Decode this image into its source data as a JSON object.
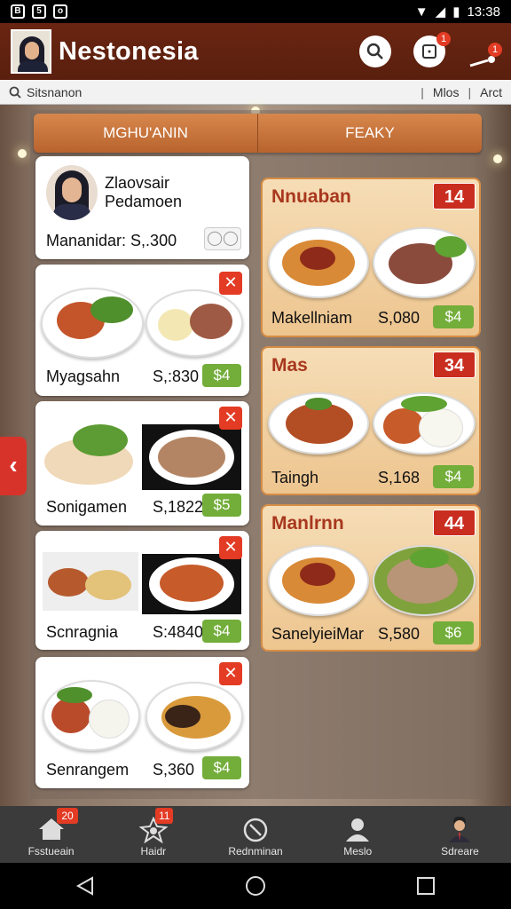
{
  "status": {
    "time": "13:38"
  },
  "app": {
    "title": "Nestonesia"
  },
  "header": {
    "notif_badge": "1",
    "alert_badge": "1"
  },
  "search": {
    "placeholder": "Sitsnanon",
    "link1": "Mlos",
    "link2": "Arct"
  },
  "tabs": [
    {
      "label": "MGHU'ANIN"
    },
    {
      "label": "FEAKY"
    }
  ],
  "profile": {
    "name_line1": "Zlaovsair",
    "name_line2": "Pedamoen",
    "balance": "Mananidar: S,.300"
  },
  "left_items": [
    {
      "name": "Myagsahn",
      "price": "S,:830",
      "tag": "$4"
    },
    {
      "name": "Sonigamen",
      "price": "S,1822",
      "tag": "$5"
    },
    {
      "name": "Scnragnia",
      "price": "S:4840",
      "tag": "$4"
    },
    {
      "name": "Senrangem",
      "price": "S,360",
      "tag": "$4"
    }
  ],
  "right_items": [
    {
      "title": "Nnuaban",
      "badge": "14",
      "name": "Makellniam",
      "price": "S,080",
      "tag": "$4"
    },
    {
      "title": "Mas",
      "badge": "34",
      "name": "Taingh",
      "price": "S,168",
      "tag": "$4"
    },
    {
      "title": "Manlrnn",
      "badge": "44",
      "name": "SanelyieiMar",
      "price": "S,580",
      "tag": "$6"
    }
  ],
  "nav": [
    {
      "label": "Fsstueain",
      "badge": "20",
      "icon": "home-icon"
    },
    {
      "label": "Haidr",
      "badge": "11",
      "icon": "star-badge-icon"
    },
    {
      "label": "Rednminan",
      "badge": "",
      "icon": "timer-icon"
    },
    {
      "label": "Meslo",
      "badge": "",
      "icon": "person-icon"
    },
    {
      "label": "Sdreare",
      "badge": "",
      "icon": "avatar-icon"
    }
  ],
  "colors": {
    "appbar": "#6a2512",
    "accent_red": "#e33b24",
    "price_green": "#73ad3a",
    "tab_orange": "#c9733b"
  }
}
